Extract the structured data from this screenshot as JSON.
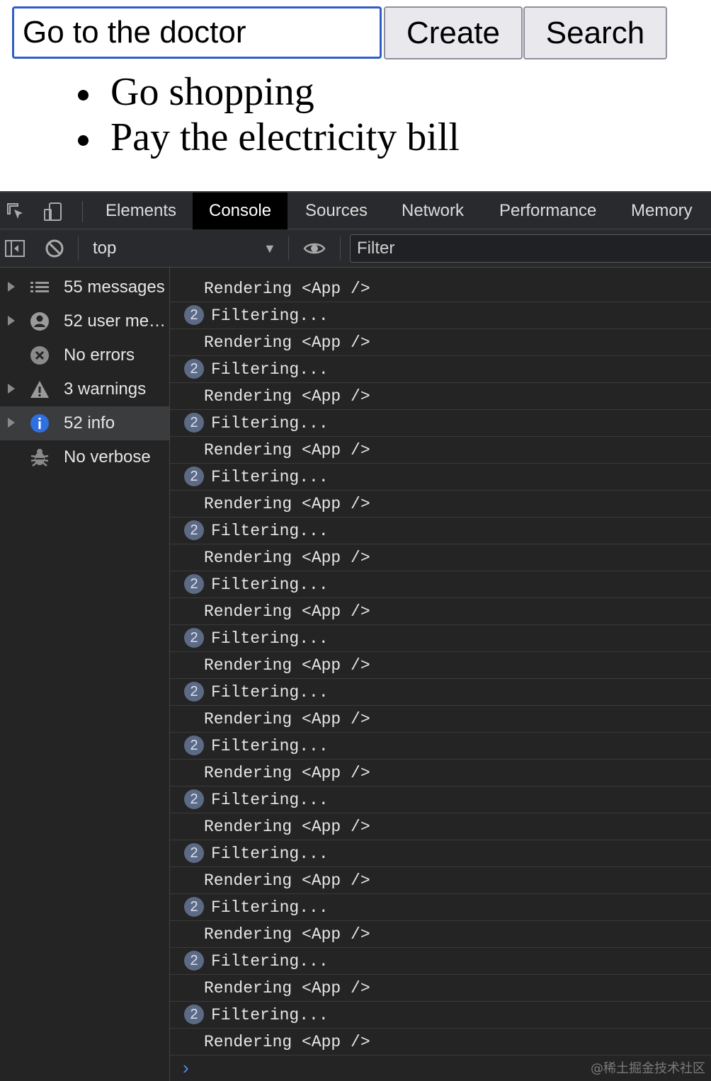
{
  "app": {
    "input_value": "Go to the doctor",
    "create_label": "Create",
    "search_label": "Search",
    "todos": [
      "Go shopping",
      "Pay the electricity bill"
    ]
  },
  "devtools": {
    "tabs": [
      "Elements",
      "Console",
      "Sources",
      "Network",
      "Performance",
      "Memory"
    ],
    "active_tab": "Console",
    "context": "top",
    "filter_placeholder": "Filter",
    "sidebar": [
      {
        "label": "55 messages",
        "icon": "list-icon",
        "expandable": true
      },
      {
        "label": "52 user me…",
        "icon": "user-icon",
        "expandable": true
      },
      {
        "label": "No errors",
        "icon": "error-icon",
        "expandable": false
      },
      {
        "label": "3 warnings",
        "icon": "warning-icon",
        "expandable": true
      },
      {
        "label": "52 info",
        "icon": "info-icon",
        "expandable": true,
        "selected": true
      },
      {
        "label": "No verbose",
        "icon": "bug-icon",
        "expandable": false
      }
    ],
    "log": [
      {
        "text": "Rendering <App />",
        "count": null
      },
      {
        "text": "Filtering...",
        "count": "2"
      },
      {
        "text": "Rendering <App />",
        "count": null
      },
      {
        "text": "Filtering...",
        "count": "2"
      },
      {
        "text": "Rendering <App />",
        "count": null
      },
      {
        "text": "Filtering...",
        "count": "2"
      },
      {
        "text": "Rendering <App />",
        "count": null
      },
      {
        "text": "Filtering...",
        "count": "2"
      },
      {
        "text": "Rendering <App />",
        "count": null
      },
      {
        "text": "Filtering...",
        "count": "2"
      },
      {
        "text": "Rendering <App />",
        "count": null
      },
      {
        "text": "Filtering...",
        "count": "2"
      },
      {
        "text": "Rendering <App />",
        "count": null
      },
      {
        "text": "Filtering...",
        "count": "2"
      },
      {
        "text": "Rendering <App />",
        "count": null
      },
      {
        "text": "Filtering...",
        "count": "2"
      },
      {
        "text": "Rendering <App />",
        "count": null
      },
      {
        "text": "Filtering...",
        "count": "2"
      },
      {
        "text": "Rendering <App />",
        "count": null
      },
      {
        "text": "Filtering...",
        "count": "2"
      },
      {
        "text": "Rendering <App />",
        "count": null
      },
      {
        "text": "Filtering...",
        "count": "2"
      },
      {
        "text": "Rendering <App />",
        "count": null
      },
      {
        "text": "Filtering...",
        "count": "2"
      },
      {
        "text": "Rendering <App />",
        "count": null
      },
      {
        "text": "Filtering...",
        "count": "2"
      },
      {
        "text": "Rendering <App />",
        "count": null
      },
      {
        "text": "Filtering...",
        "count": "2"
      },
      {
        "text": "Rendering <App />",
        "count": null
      }
    ],
    "colors": {
      "panel": "#242424",
      "accent": "#4e8cf0",
      "info": "#2f6fe0"
    }
  },
  "watermark": "@稀土掘金技术社区"
}
